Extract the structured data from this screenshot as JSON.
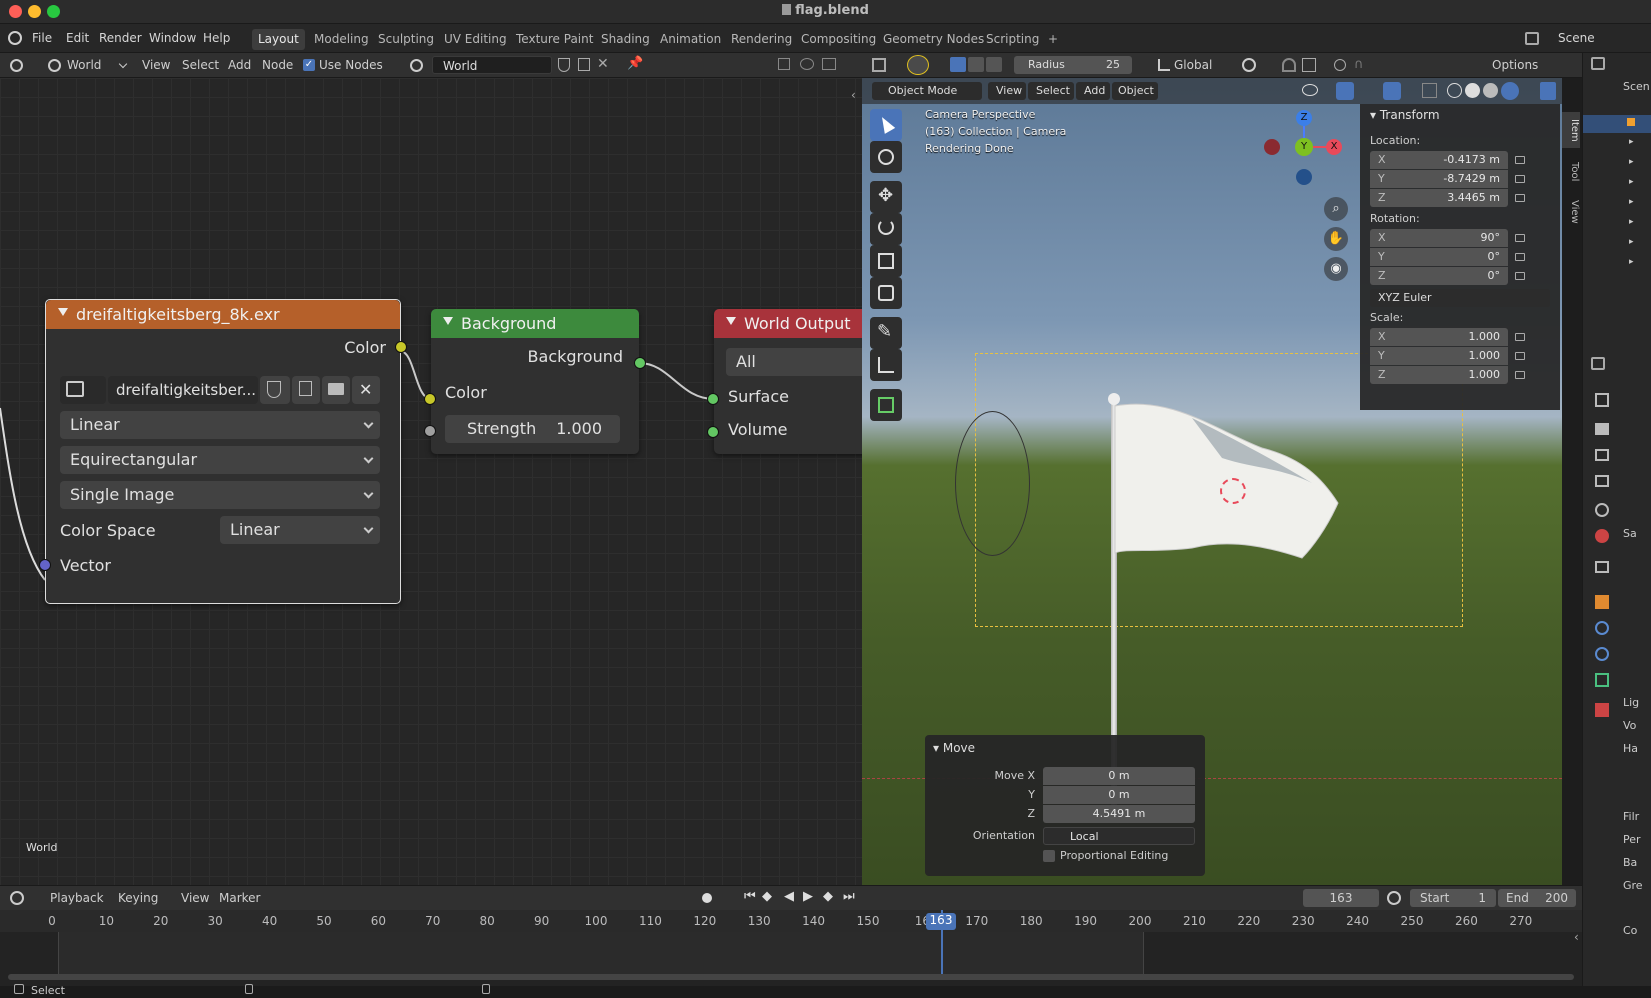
{
  "window": {
    "title": "flag.blend"
  },
  "topbar": {
    "menus": [
      "File",
      "Edit",
      "Render",
      "Window",
      "Help"
    ],
    "workspaces": [
      "Layout",
      "Modeling",
      "Sculpting",
      "UV Editing",
      "Texture Paint",
      "Shading",
      "Animation",
      "Rendering",
      "Compositing",
      "Geometry Nodes",
      "Scripting"
    ],
    "active_workspace": "Layout",
    "add_tab": "+",
    "scene_label": "Scene"
  },
  "node_editor": {
    "header": {
      "shader_type": "World",
      "menus": [
        "View",
        "Select",
        "Add",
        "Node"
      ],
      "use_nodes_label": "Use Nodes",
      "use_nodes_checked": true,
      "world_name": "World"
    },
    "footer_label": "World",
    "nodes": {
      "env_texture": {
        "title": "dreifaltigkeitsberg_8k.exr",
        "output_color": "Color",
        "image_name": "dreifaltigkeitsber...",
        "interpolation": "Linear",
        "projection": "Equirectangular",
        "source": "Single Image",
        "color_space_label": "Color Space",
        "color_space_value": "Linear",
        "input_vector": "Vector"
      },
      "background": {
        "title": "Background",
        "output": "Background",
        "input_color": "Color",
        "strength_label": "Strength",
        "strength_value": "1.000"
      },
      "world_output": {
        "title": "World Output",
        "target": "All",
        "input_surface": "Surface",
        "input_volume": "Volume"
      }
    }
  },
  "viewport": {
    "header": {
      "radius_label": "Radius",
      "radius_value": "25",
      "orientation": "Global",
      "options_label": "Options",
      "mode": "Object Mode",
      "menus": [
        "View",
        "Select",
        "Add",
        "Object"
      ]
    },
    "overlay_text": [
      "Camera Perspective",
      "(163) Collection | Camera",
      "Rendering Done"
    ],
    "gizmo": {
      "z": "Z",
      "y": "Y",
      "x": "X"
    },
    "side_tabs": [
      "Item",
      "Tool",
      "View"
    ],
    "transform": {
      "title": "Transform",
      "location_label": "Location:",
      "location": [
        {
          "axis": "X",
          "value": "-0.4173 m"
        },
        {
          "axis": "Y",
          "value": "-8.7429 m"
        },
        {
          "axis": "Z",
          "value": "3.4465 m"
        }
      ],
      "rotation_label": "Rotation:",
      "rotation": [
        {
          "axis": "X",
          "value": "90°"
        },
        {
          "axis": "Y",
          "value": "0°"
        },
        {
          "axis": "Z",
          "value": "0°"
        }
      ],
      "rotation_mode": "XYZ Euler",
      "scale_label": "Scale:",
      "scale": [
        {
          "axis": "X",
          "value": "1.000"
        },
        {
          "axis": "Y",
          "value": "1.000"
        },
        {
          "axis": "Z",
          "value": "1.000"
        }
      ]
    },
    "move_panel": {
      "title": "Move",
      "move_x_label": "Move X",
      "move_x": "0 m",
      "y_label": "Y",
      "move_y": "0 m",
      "z_label": "Z",
      "move_z": "4.5491 m",
      "orientation_label": "Orientation",
      "orientation_value": "Local",
      "proportional_label": "Proportional Editing"
    }
  },
  "outliner": {
    "scene_label": "Scen"
  },
  "properties": {
    "section_labels": [
      "Sa",
      "Lig",
      "Vo",
      "Ha",
      "Filr",
      "Per",
      "Ba",
      "Gre",
      "Co"
    ]
  },
  "timeline": {
    "menus": [
      "Playback",
      "Keying",
      "View",
      "Marker"
    ],
    "current_frame": "163",
    "start_label": "Start",
    "start_value": "1",
    "end_label": "End",
    "end_value": "200",
    "ticks": [
      "0",
      "10",
      "20",
      "30",
      "40",
      "50",
      "60",
      "70",
      "80",
      "90",
      "100",
      "110",
      "120",
      "130",
      "140",
      "150",
      "16",
      "170",
      "180",
      "190",
      "200",
      "210",
      "220",
      "230",
      "240",
      "250",
      "260",
      "270"
    ],
    "frame_marker": "163"
  },
  "statusbar": {
    "left": "Select"
  },
  "colors": {
    "texture_header": "#b5602a",
    "background_header": "#3d8a3d",
    "output_header": "#a8333b",
    "socket_color": "#c7c729",
    "socket_shader": "#63c763",
    "socket_vector": "#6363c7",
    "accent": "#4a74b8"
  }
}
